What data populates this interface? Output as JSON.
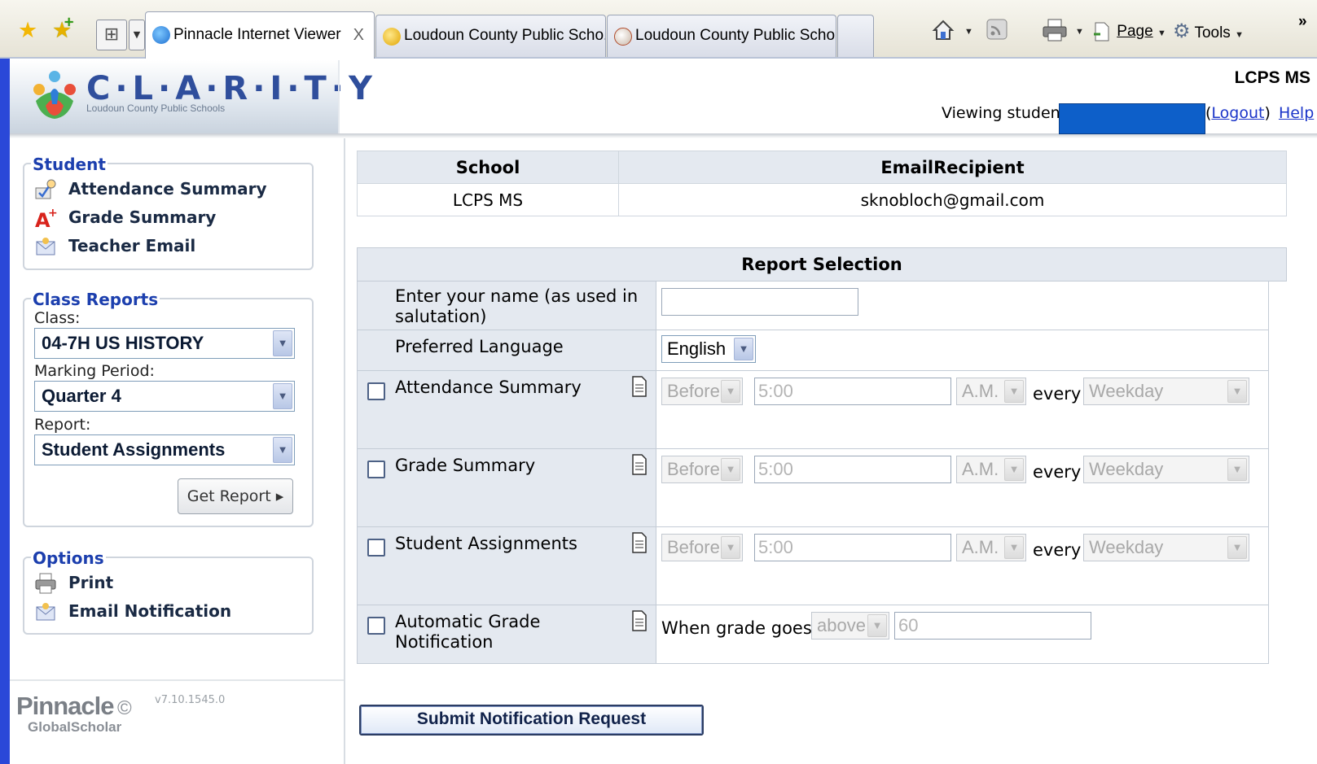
{
  "browser": {
    "tabs": [
      {
        "label": "Pinnacle Internet Viewer",
        "close": "X",
        "active": true
      },
      {
        "label": "Loudoun County Public Scho...",
        "active": false
      },
      {
        "label": "Loudoun County Public Scho...",
        "active": false
      }
    ],
    "toolbar": {
      "page_label": "Page",
      "tools_label": "Tools",
      "overflow": "»"
    }
  },
  "header": {
    "logo_title": "C·L·A·R·I·T·Y",
    "logo_subtitle": "Loudoun County Public Schools",
    "school": "LCPS MS",
    "viewing_label": "Viewing studen",
    "logout_label": "Logout",
    "help_label": "Help"
  },
  "sidebar": {
    "student": {
      "legend": "Student",
      "items": [
        "Attendance Summary",
        "Grade Summary",
        "Teacher Email"
      ]
    },
    "class_reports": {
      "legend": "Class Reports",
      "class_label": "Class:",
      "class_value": "04-7H US HISTORY",
      "period_label": "Marking Period:",
      "period_value": "Quarter 4",
      "report_label": "Report:",
      "report_value": "Student Assignments",
      "get_report": "Get Report ▸"
    },
    "options": {
      "legend": "Options",
      "items": [
        "Print",
        "Email Notification"
      ]
    },
    "footer": {
      "brand": "Pinnacle",
      "sub": "GlobalScholar",
      "version": "v7.10.1545.0"
    }
  },
  "main": {
    "school_table": {
      "headers": [
        "School",
        "EmailRecipient"
      ],
      "row": [
        "LCPS MS",
        "sknobloch@gmail.com"
      ]
    },
    "report": {
      "title": "Report Selection",
      "name_label": "Enter your name (as used in salutation)",
      "name_value": "",
      "language_label": "Preferred Language",
      "language_value": "English",
      "rows": [
        {
          "label": "Attendance Summary",
          "when": "Before",
          "time": "5:00",
          "ampm": "A.M.",
          "every": "every",
          "freq": "Weekday"
        },
        {
          "label": "Grade Summary",
          "when": "Before",
          "time": "5:00",
          "ampm": "A.M.",
          "every": "every",
          "freq": "Weekday"
        },
        {
          "label": "Student Assignments",
          "when": "Before",
          "time": "5:00",
          "ampm": "A.M.",
          "every": "every",
          "freq": "Weekday"
        }
      ],
      "auto": {
        "label": "Automatic Grade Notification",
        "when_text": "When grade goes",
        "direction": "above",
        "threshold": "60"
      }
    },
    "submit_label": "Submit Notification Request"
  }
}
